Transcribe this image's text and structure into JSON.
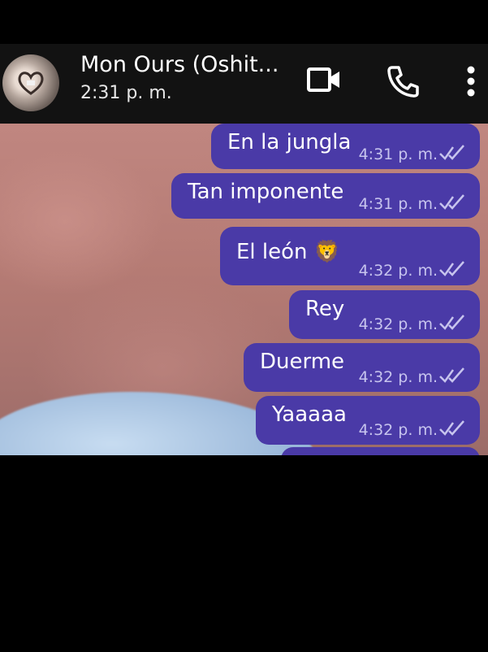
{
  "header": {
    "contact_name": "Mon Ours (Oshit...",
    "status_time": "2:31 p. m."
  },
  "icons": {
    "avatar": "avatar-heart-hands",
    "video": "video-call-icon",
    "phone": "phone-call-icon",
    "more": "more-vert-icon",
    "read": "double-check-icon"
  },
  "colors": {
    "bubble": "#4a3aa7",
    "header": "#121212"
  },
  "messages": [
    {
      "text": "En la jungla",
      "time": "4:31 p. m."
    },
    {
      "text": "Tan imponente",
      "time": "4:31 p. m."
    },
    {
      "text": "El león 🦁",
      "time": "4:32 p. m."
    },
    {
      "text": "Rey",
      "time": "4:32 p. m."
    },
    {
      "text": "Duerme",
      "time": "4:32 p. m."
    },
    {
      "text": "Yaaaaa",
      "time": "4:32 p. m."
    }
  ]
}
